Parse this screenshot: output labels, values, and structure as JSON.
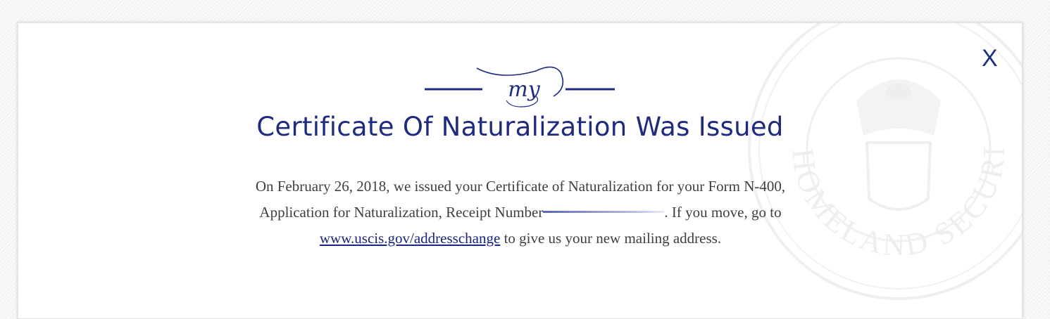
{
  "modal": {
    "close_label": "X",
    "logo_text": "my",
    "title": "Certificate Of Naturalization Was Issued",
    "message": {
      "part1": "On February 26, 2018, we issued your Certificate of Naturalization for your Form N-400, Application for Naturalization, Receipt Number",
      "part2": ". If you move, go to ",
      "link_text": "www.uscis.gov/addresschange",
      "part3": " to give us your new mailing address."
    },
    "seal_text": "HOMELAND SECURITY"
  },
  "colors": {
    "accent": "#1f2b80",
    "body_text": "#3f3f3f",
    "link": "#1a237e"
  },
  "icons": {
    "close": "close-icon",
    "seal": "dhs-seal-watermark"
  }
}
